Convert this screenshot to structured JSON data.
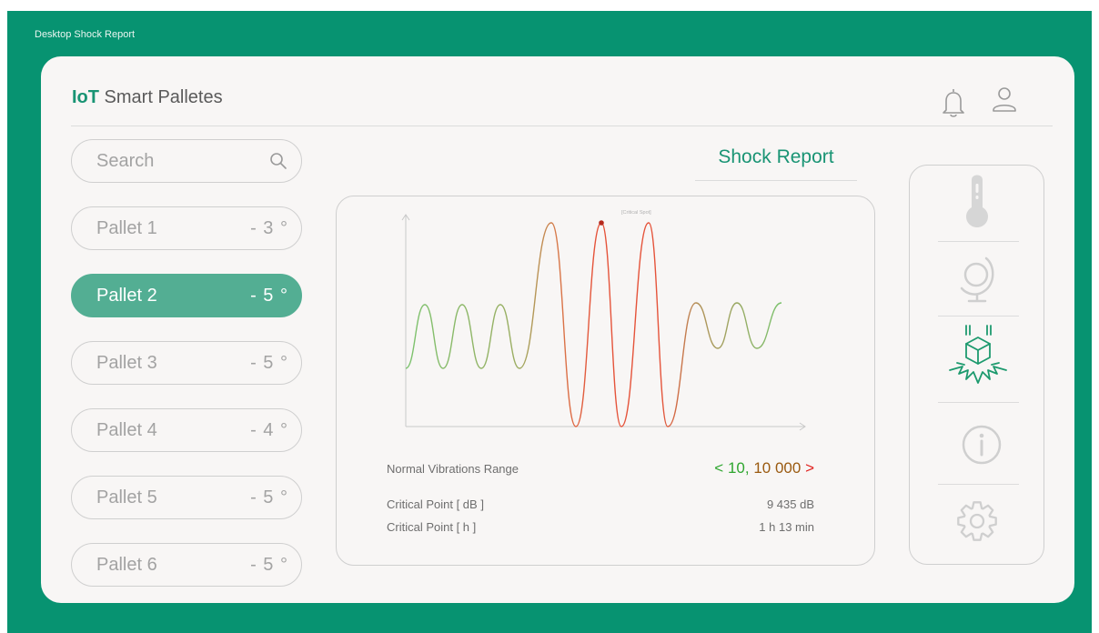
{
  "window": {
    "title": "Desktop Shock Report"
  },
  "header": {
    "brand_bold": "IoT",
    "brand_rest": " Smart Palletes"
  },
  "icons": {
    "notifications": "bell-icon",
    "account": "user-icon",
    "search": "search-icon"
  },
  "search": {
    "placeholder": "Search"
  },
  "pallets": [
    {
      "name": "Pallet 1",
      "tilt": "- 3 °"
    },
    {
      "name": "Pallet 2",
      "tilt": "- 5 °",
      "selected": true
    },
    {
      "name": "Pallet 3",
      "tilt": "- 5 °"
    },
    {
      "name": "Pallet 4",
      "tilt": "- 4 °"
    },
    {
      "name": "Pallet 5",
      "tilt": "- 5 °"
    },
    {
      "name": "Pallet 6",
      "tilt": "- 5 °"
    }
  ],
  "report": {
    "title": "Shock Report",
    "chart_annotation": "[Critical Spot]",
    "range_label": "Normal Vibrations Range",
    "range_value_low": "< 10,",
    "range_value_high": "10 000",
    "range_value_close": ">",
    "critical_db_label": "Critical Point [ dB ]",
    "critical_db_value": "9 435 dB",
    "critical_h_label": "Critical Point [ h ]",
    "critical_h_value": "1 h 13 min"
  },
  "side_nav": [
    {
      "icon": "thermometer-icon",
      "active": false
    },
    {
      "icon": "globe-icon",
      "active": false
    },
    {
      "icon": "shock-box-icon",
      "active": true
    },
    {
      "icon": "info-icon",
      "active": false
    },
    {
      "icon": "settings-gear-icon",
      "active": false
    }
  ],
  "colors": {
    "background": "#079371",
    "brand": "#199474",
    "selected_pill": "#53ae93",
    "wave_normal": "#7cc36e",
    "wave_critical": "#e5533a",
    "range_low": "#2fa62f",
    "range_mid": "#9a5a10",
    "range_high": "#e0201d"
  }
}
